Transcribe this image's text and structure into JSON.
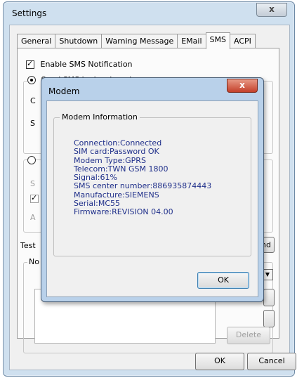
{
  "window": {
    "title": "Settings",
    "close_glyph": "x",
    "tabs": [
      "General",
      "Shutdown",
      "Warning Message",
      "EMail",
      "SMS",
      "ACPI"
    ],
    "active_tab": "SMS",
    "enable_sms_label": "Enable SMS Notification",
    "send_local_label": "Send SMS by local modem:",
    "fragments": {
      "row_c": "C",
      "row_s": "S",
      "row_s2": "S",
      "row_a": "A",
      "test_label": "Test",
      "no_label": "No",
      "nd_label": "nd"
    },
    "delete_label": "Delete",
    "ok_label": "OK",
    "cancel_label": "Cancel"
  },
  "modem": {
    "title": "Modem",
    "close_glyph": "x",
    "group_label": "Modem Information",
    "lines": [
      "Connection:Connected",
      "SIM card:Password OK",
      "Modem Type:GPRS",
      "Telecom:TWN GSM 1800",
      "Signal:61%",
      "SMS center number:886935874443",
      "Manufacture:SIEMENS",
      "Serial:MC55",
      "Firmware:REVISION 04.00"
    ],
    "ok_label": "OK"
  }
}
